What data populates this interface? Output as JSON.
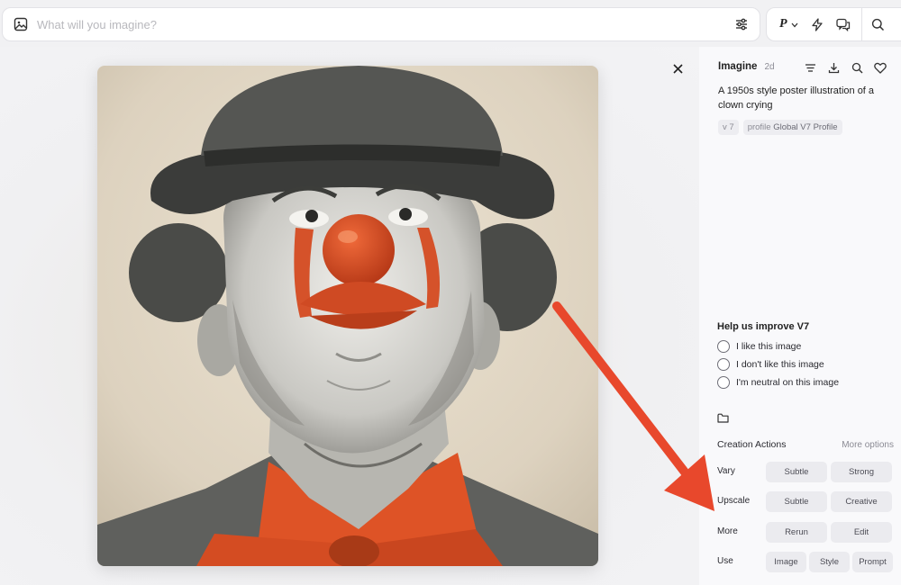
{
  "prompt_bar": {
    "placeholder": "What will you imagine?"
  },
  "toolbar": {
    "profile_letter": "P"
  },
  "panel": {
    "mode": "Imagine",
    "age": "2d",
    "prompt": "A 1950s style poster illustration of a clown crying",
    "tags": [
      {
        "prefix": "",
        "value": "v 7"
      },
      {
        "prefix": "profile",
        "value": "Global V7 Profile"
      }
    ],
    "feedback": {
      "title": "Help us improve V7",
      "options": [
        "I like this image",
        "I don't like this image",
        "I'm neutral on this image"
      ]
    },
    "creation_actions": {
      "title": "Creation Actions",
      "more": "More options",
      "rows": [
        {
          "label": "Vary",
          "buttons": [
            "Subtle",
            "Strong"
          ]
        },
        {
          "label": "Upscale",
          "buttons": [
            "Subtle",
            "Creative"
          ]
        },
        {
          "label": "More",
          "buttons": [
            "Rerun",
            "Edit"
          ]
        },
        {
          "label": "Use",
          "buttons": [
            "Image",
            "Style",
            "Prompt"
          ]
        }
      ]
    }
  },
  "colors": {
    "accent_arrow": "#e8482c",
    "clown_orange": "#e0552b"
  }
}
